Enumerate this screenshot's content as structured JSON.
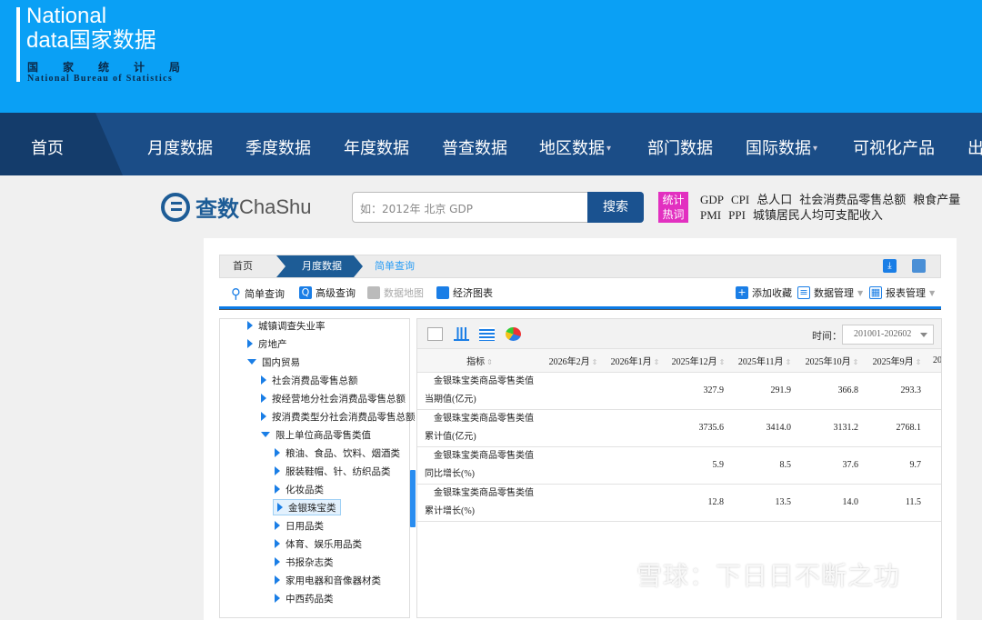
{
  "logo": {
    "line1": "National",
    "line2": "data国家数据",
    "line3": "国家统计局",
    "line4": "National Bureau of Statistics"
  },
  "nav": [
    {
      "label": "首页"
    },
    {
      "label": "月度数据"
    },
    {
      "label": "季度数据"
    },
    {
      "label": "年度数据"
    },
    {
      "label": "普查数据"
    },
    {
      "label": "地区数据",
      "caret": "▾"
    },
    {
      "label": "部门数据"
    },
    {
      "label": "国际数据",
      "caret": "▾"
    },
    {
      "label": "可视化产品"
    },
    {
      "label": "出"
    }
  ],
  "search": {
    "logo_cn": "查数",
    "logo_en": "ChaShu",
    "placeholder": "如：2012年 北京 GDP",
    "button": "搜索",
    "hot_badge": "统计热词",
    "hot_words_row1": [
      "GDP",
      "CPI",
      "总人口",
      "社会消费品零售总额",
      "粮食产量"
    ],
    "hot_words_row2": [
      "PMI",
      "PPI",
      "城镇居民人均可支配收入"
    ]
  },
  "breadcrumb": [
    "首页",
    "月度数据",
    "简单查询"
  ],
  "toolbar": {
    "simple": "简单查询",
    "advanced": "高级查询",
    "map": "数据地图",
    "chart": "经济图表",
    "fav": "添加收藏",
    "data_mgmt": "数据管理",
    "report_mgmt": "报表管理"
  },
  "tree": [
    {
      "label": "城镇调查失业率",
      "level": 1,
      "open": false
    },
    {
      "label": "房地产",
      "level": 1,
      "open": false
    },
    {
      "label": "国内贸易",
      "level": 1,
      "open": true
    },
    {
      "label": "社会消费品零售总额",
      "level": 2,
      "open": false
    },
    {
      "label": "按经营地分社会消费品零售总额",
      "level": 2,
      "open": false
    },
    {
      "label": "按消费类型分社会消费品零售总额",
      "level": 2,
      "open": false
    },
    {
      "label": "限上单位商品零售类值",
      "level": 2,
      "open": true
    },
    {
      "label": "粮油、食品、饮料、烟酒类",
      "level": 3,
      "open": false
    },
    {
      "label": "服装鞋帽、针、纺织品类",
      "level": 3,
      "open": false
    },
    {
      "label": "化妆品类",
      "level": 3,
      "open": false
    },
    {
      "label": "金银珠宝类",
      "level": 3,
      "open": false,
      "selected": true
    },
    {
      "label": "日用品类",
      "level": 3,
      "open": false
    },
    {
      "label": "体育、娱乐用品类",
      "level": 3,
      "open": false
    },
    {
      "label": "书报杂志类",
      "level": 3,
      "open": false
    },
    {
      "label": "家用电器和音像器材类",
      "level": 3,
      "open": false
    },
    {
      "label": "中西药品类",
      "level": 3,
      "open": false
    }
  ],
  "table": {
    "time_label": "时间：",
    "time_value": "201001-202602",
    "headers": [
      "指标",
      "2026年2月",
      "2026年1月",
      "2025年12月",
      "2025年11月",
      "2025年10月",
      "2025年9月",
      "20"
    ],
    "rows": [
      {
        "ind1": "金银珠宝类商品零售类值",
        "ind2": "当期值(亿元)",
        "values": [
          "",
          "",
          "327.9",
          "291.9",
          "366.8",
          "293.3",
          ""
        ]
      },
      {
        "ind1": "金银珠宝类商品零售类值",
        "ind2": "累计值(亿元)",
        "values": [
          "",
          "",
          "3735.6",
          "3414.0",
          "3131.2",
          "2768.1",
          ""
        ]
      },
      {
        "ind1": "金银珠宝类商品零售类值",
        "ind2": "同比增长(%)",
        "values": [
          "",
          "",
          "5.9",
          "8.5",
          "37.6",
          "9.7",
          ""
        ]
      },
      {
        "ind1": "金银珠宝类商品零售类值",
        "ind2": "累计增长(%)",
        "values": [
          "",
          "",
          "12.8",
          "13.5",
          "14.0",
          "11.5",
          ""
        ]
      }
    ]
  },
  "watermark": "雪球：下日日不断之功"
}
